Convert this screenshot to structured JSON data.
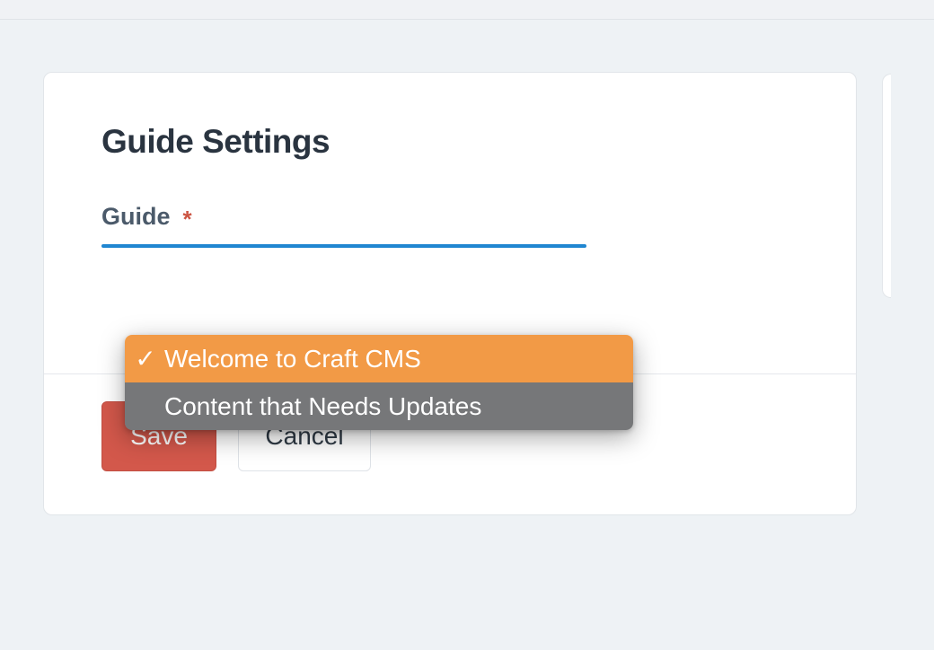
{
  "header": {
    "title": "Guide Settings"
  },
  "field": {
    "label": "Guide",
    "required_mark": "*"
  },
  "dropdown": {
    "options": [
      {
        "label": "Welcome to Craft CMS",
        "selected": true
      },
      {
        "label": "Content that Needs Updates",
        "selected": false
      }
    ],
    "checkmark": "✓"
  },
  "footer": {
    "save_label": "Save",
    "cancel_label": "Cancel"
  },
  "colors": {
    "accent_orange": "#f29a46",
    "dropdown_grey": "#767779",
    "save_red": "#d3584b",
    "focus_blue": "#1f86d1"
  }
}
